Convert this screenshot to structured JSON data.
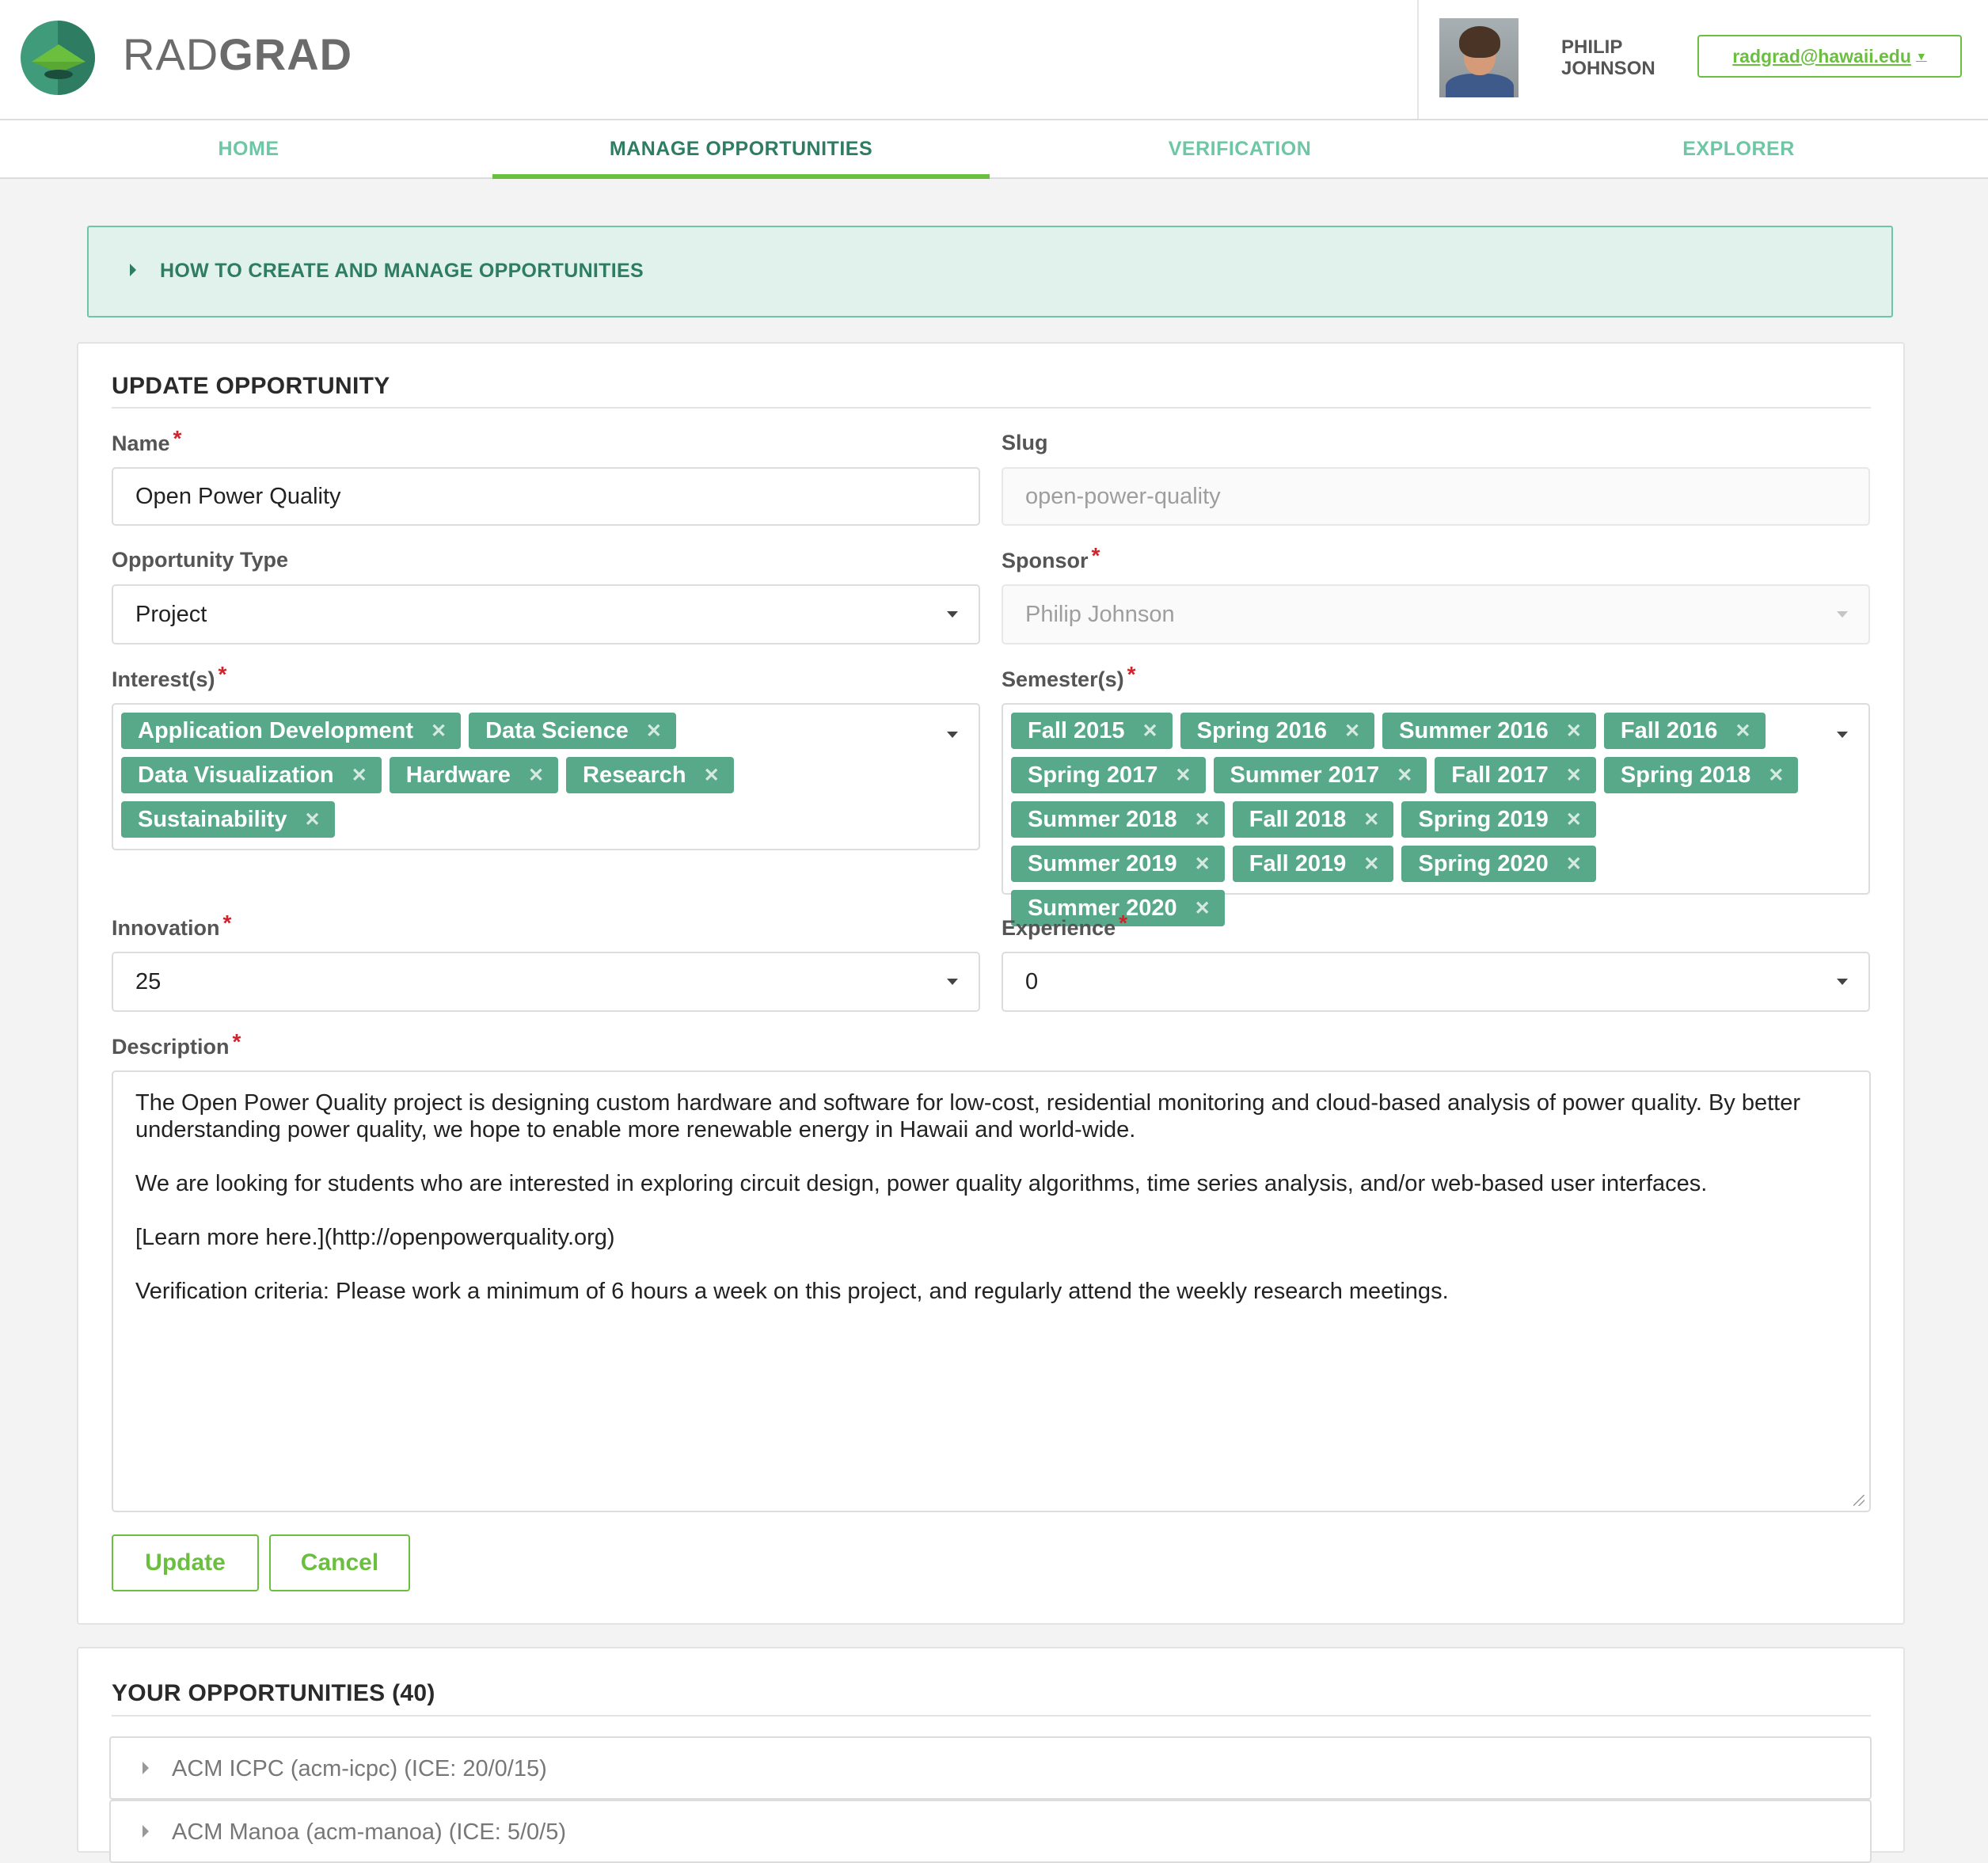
{
  "header": {
    "brand": {
      "light": "RAD",
      "bold": "GRAD"
    },
    "user_name": "PHILIP JOHNSON",
    "email_button": "radgrad@hawaii.edu"
  },
  "nav": {
    "tabs": [
      {
        "label": "HOME",
        "active": false
      },
      {
        "label": "MANAGE OPPORTUNITIES",
        "active": true
      },
      {
        "label": "VERIFICATION",
        "active": false
      },
      {
        "label": "EXPLORER",
        "active": false
      }
    ]
  },
  "help": {
    "title": "HOW TO CREATE AND MANAGE OPPORTUNITIES"
  },
  "form": {
    "title": "UPDATE OPPORTUNITY",
    "name": {
      "label": "Name",
      "value": "Open Power Quality"
    },
    "slug": {
      "label": "Slug",
      "value": "open-power-quality"
    },
    "type": {
      "label": "Opportunity Type",
      "value": "Project"
    },
    "sponsor": {
      "label": "Sponsor",
      "value": "Philip Johnson"
    },
    "interests": {
      "label": "Interest(s)",
      "items": [
        "Application Development",
        "Data Science",
        "Data Visualization",
        "Hardware",
        "Research",
        "Sustainability"
      ]
    },
    "semesters": {
      "label": "Semester(s)",
      "items": [
        "Fall 2015",
        "Spring 2016",
        "Summer 2016",
        "Fall 2016",
        "Spring 2017",
        "Summer 2017",
        "Fall 2017",
        "Spring 2018",
        "Summer 2018",
        "Fall 2018",
        "Spring 2019",
        "Summer 2019",
        "Fall 2019",
        "Spring 2020",
        "Summer 2020"
      ]
    },
    "innovation": {
      "label": "Innovation",
      "value": "25"
    },
    "experience": {
      "label": "Experience",
      "value": "0"
    },
    "description": {
      "label": "Description",
      "paragraphs": [
        "The Open Power Quality project is designing custom hardware and software for low-cost, residential monitoring and cloud-based analysis of power quality. By better understanding power quality, we hope to enable more renewable energy in Hawaii and world-wide.",
        "We are looking for students who are interested in exploring circuit design, power quality algorithms, time series analysis, and/or web-based user interfaces.",
        "[Learn more here.](http://openpowerquality.org)",
        "Verification criteria:  Please work a minimum of 6 hours a week on this project, and regularly attend the weekly research meetings."
      ]
    },
    "update_button": "Update",
    "cancel_button": "Cancel",
    "required_mark": "*"
  },
  "list": {
    "title": "YOUR OPPORTUNITIES (40)",
    "items": [
      "ACM ICPC (acm-icpc) (ICE: 20/0/15)",
      "ACM Manoa (acm-manoa) (ICE: 5/0/5)"
    ]
  },
  "colors": {
    "accent_green": "#6bbf3f",
    "teal_dark": "#2e7d62",
    "teal_light": "#6dc7a4",
    "chip": "#57a98a",
    "required": "#d0232c"
  }
}
